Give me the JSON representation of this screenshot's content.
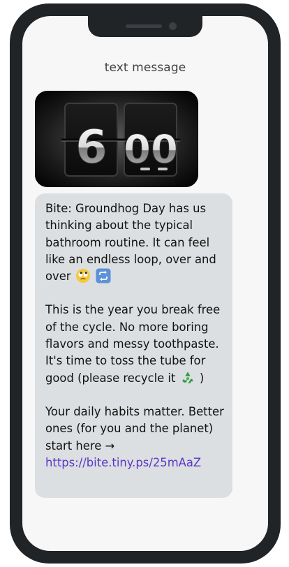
{
  "header": {
    "title": "text message"
  },
  "gif": {
    "digits": [
      "6",
      "00"
    ]
  },
  "message": {
    "paragraph1": "Bite: Groundhog Day has us thinking about the typical bathroom routine. It can feel like an endless loop, over and over",
    "paragraph2": "This is the year you break free of the cycle. No more boring flavors and messy toothpaste. It's time to toss the tube for good (please recycle it",
    "paragraph2_end": ")",
    "paragraph3": "Your daily habits matter. Better ones (for you and the planet) start here →",
    "link": "https://bite.tiny.ps/25mAaZ"
  },
  "emojis": [
    "eye-roll-face-icon",
    "repeat-arrows-icon",
    "recycle-icon"
  ],
  "colors": {
    "phone_frame": "#212427",
    "screen_bg": "#f7f7f7",
    "bubble_bg": "#dcdfe1",
    "link": "#5b36c8"
  }
}
